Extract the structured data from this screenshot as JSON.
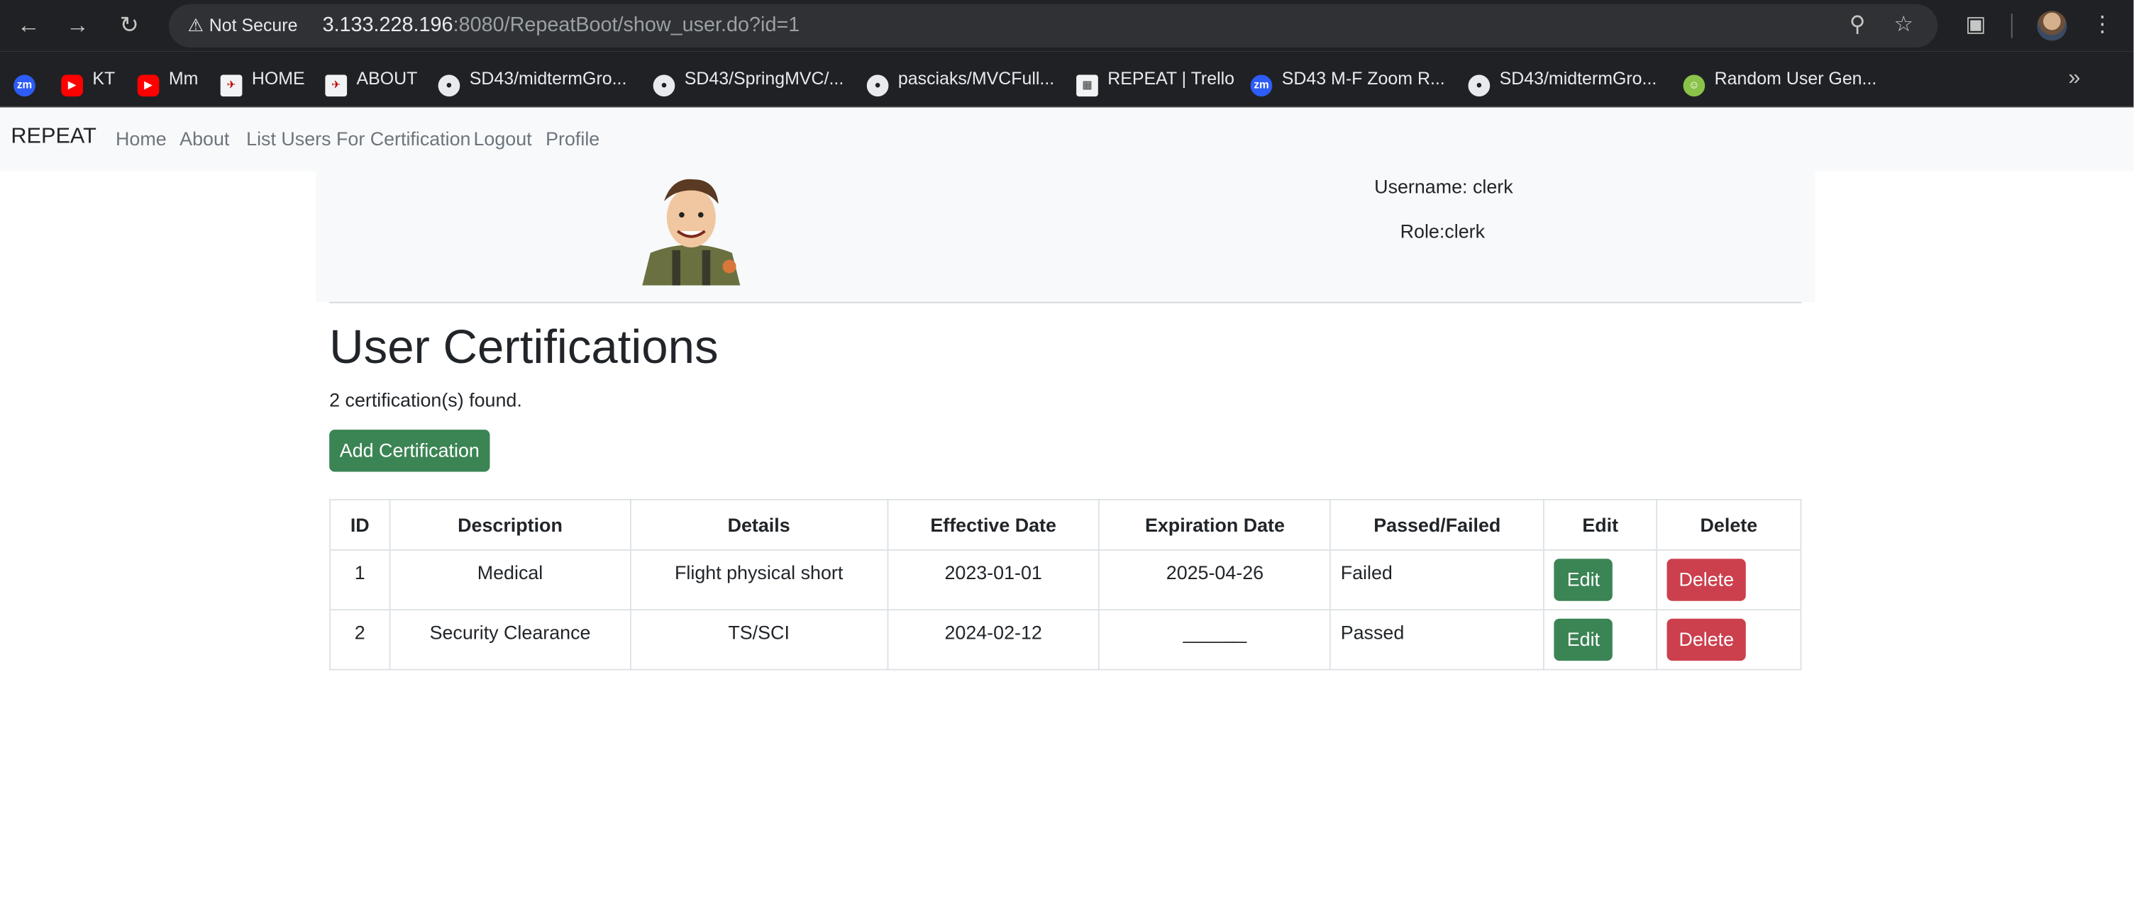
{
  "browser": {
    "security_label": "Not Secure",
    "url_host": "3.133.228.196",
    "url_rest": ":8080/RepeatBoot/show_user.do?id=1",
    "bookmarks": [
      {
        "label": "KT"
      },
      {
        "label": "Mm"
      },
      {
        "label": "HOME"
      },
      {
        "label": "ABOUT"
      },
      {
        "label": "SD43/midtermGro..."
      },
      {
        "label": "SD43/SpringMVC/..."
      },
      {
        "label": "pasciaks/MVCFull..."
      },
      {
        "label": "REPEAT | Trello"
      },
      {
        "label": "SD43 M-F Zoom R..."
      },
      {
        "label": "SD43/midtermGro..."
      },
      {
        "label": "Random User Gen..."
      }
    ]
  },
  "navbar": {
    "brand": "REPEAT",
    "links": [
      "Home",
      "About",
      "List Users For Certification",
      "Logout",
      "Profile"
    ]
  },
  "profile": {
    "username": "Username: clerk",
    "role": "Role:clerk"
  },
  "main": {
    "title": "User Certifications",
    "count_text": "2 certification(s) found.",
    "add_button": "Add Certification"
  },
  "table": {
    "headers": [
      "ID",
      "Description",
      "Details",
      "Effective Date",
      "Expiration Date",
      "Passed/Failed",
      "Edit",
      "Delete"
    ],
    "rows": [
      {
        "id": "1",
        "description": "Medical",
        "details": "Flight physical short",
        "effective": "2023-01-01",
        "expiration": "2025-04-26",
        "status": "Failed",
        "edit": "Edit",
        "delete": "Delete"
      },
      {
        "id": "2",
        "description": "Security Clearance",
        "details": "TS/SCI",
        "effective": "2024-02-12",
        "expiration": "______",
        "status": "Passed",
        "edit": "Edit",
        "delete": "Delete"
      }
    ]
  },
  "colors": {
    "success": "#3b8454",
    "danger": "#cc3f4d",
    "navbar_bg": "#f8f9fa",
    "chrome_bg": "#202124"
  }
}
